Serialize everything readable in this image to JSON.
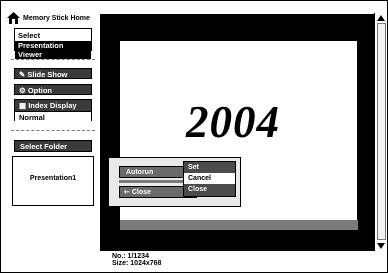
{
  "sidebar": {
    "home": "Memory Stick Home",
    "select_line1": "Select",
    "select_line2": "Presentation Viewer",
    "slide_show": "Slide Show",
    "option": "Option",
    "index_display": "Index Display",
    "index_mode": "Normal",
    "select_folder": "Select Folder",
    "folder_item": "Presentation1"
  },
  "stage": {
    "title_text": "2004"
  },
  "info": {
    "no_line": "No.: 1/1234",
    "size_line": "Size: 1024x768"
  },
  "popup": {
    "autorun": "Autorun",
    "close": "Close",
    "submenu": [
      "Set",
      "Cancel",
      "Close"
    ],
    "selected": "Cancel"
  }
}
